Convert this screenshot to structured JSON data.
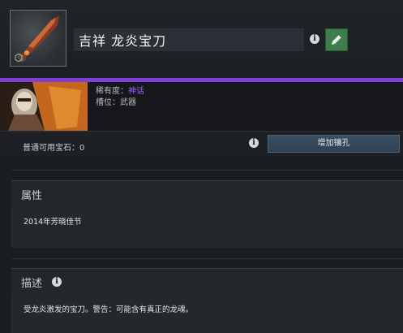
{
  "item": {
    "title": "吉祥 龙炎宝刀",
    "rarity_label": "稀有度：",
    "rarity_value": "神话",
    "slot_label": "槽位：",
    "slot_value": "武器"
  },
  "gems": {
    "text": "普通可用宝石：0",
    "add_socket_label": "增加镶孔"
  },
  "attributes": {
    "title": "属性",
    "body": "2014年芳晓佳节"
  },
  "description": {
    "title": "描述",
    "body": "受龙炎激发的宝刀。警告：可能含有真正的龙魂。"
  },
  "colors": {
    "rarity": "#9a5cff",
    "edit_button": "#3e7d4c"
  },
  "icons": {
    "item_thumb": "sword-thumbnail",
    "socket": "gem-socket-icon",
    "info": "info-icon",
    "edit": "pencil-icon",
    "hero": "hero-portrait"
  }
}
